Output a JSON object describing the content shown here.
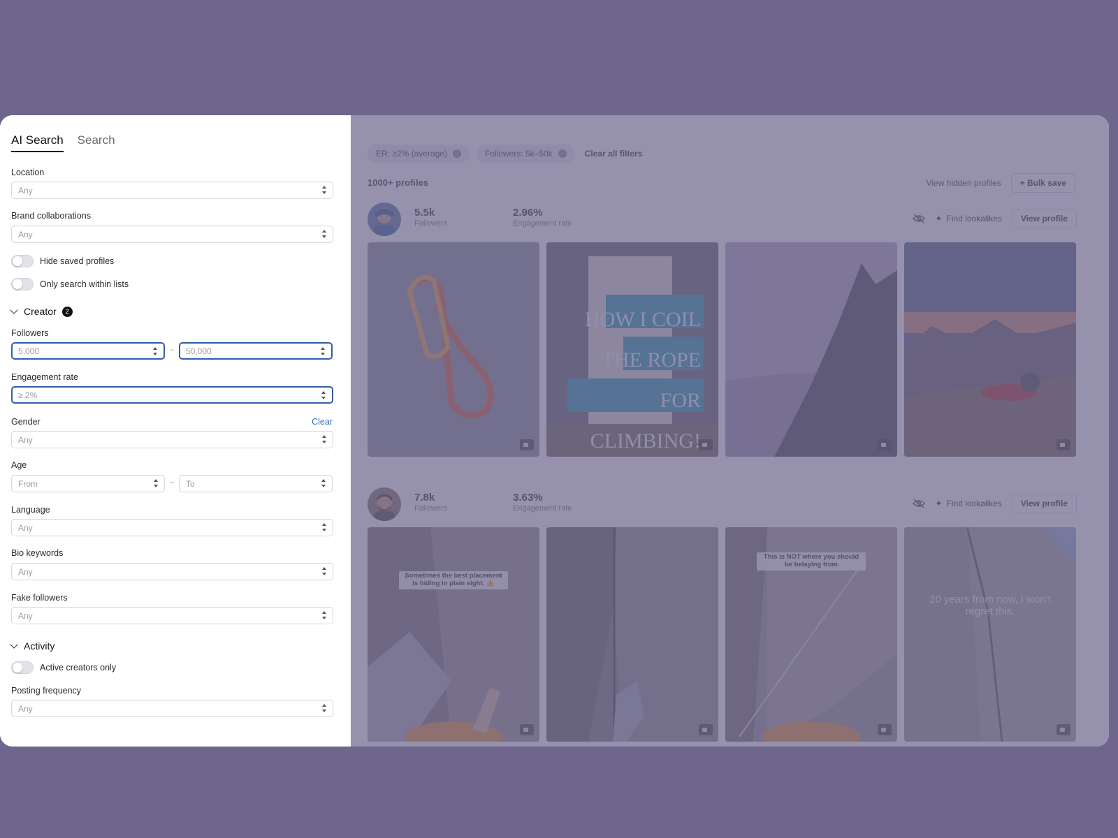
{
  "tabs": {
    "ai_search": "AI Search",
    "search": "Search"
  },
  "filters": {
    "location": {
      "label": "Location",
      "value": "Any"
    },
    "brand": {
      "label": "Brand collaborations",
      "value": "Any"
    },
    "hide_saved": "Hide saved profiles",
    "only_lists": "Only search within lists",
    "creator_section": "Creator",
    "creator_badge": "2",
    "followers": {
      "label": "Followers",
      "min": "5,000",
      "max": "50,000",
      "sep": "–"
    },
    "engagement": {
      "label": "Engagement rate",
      "value": "≥ 2%"
    },
    "gender": {
      "label": "Gender",
      "clear": "Clear",
      "value": "Any"
    },
    "age": {
      "label": "Age",
      "from": "From",
      "to": "To",
      "sep": "–"
    },
    "language": {
      "label": "Language",
      "value": "Any"
    },
    "bio": {
      "label": "Bio keywords",
      "value": "Any"
    },
    "fake": {
      "label": "Fake followers",
      "value": "Any"
    },
    "activity_section": "Activity",
    "active_only": "Active creators only",
    "posting": {
      "label": "Posting frequency",
      "value": "Any"
    }
  },
  "chips": [
    {
      "label": "ER: ≥2% (average)"
    },
    {
      "label": "Followers: 5k–50k"
    }
  ],
  "clear_all": "Clear all filters",
  "results_count": "1000+ profiles",
  "view_hidden": "View hidden profiles",
  "bulk_save": "+ Bulk save",
  "creators": [
    {
      "followers_value": "5.5k",
      "followers_label": "Followers",
      "er_value": "2.96%",
      "er_label": "Engagement rate",
      "find_label": "Find lookalikes",
      "view_label": "View profile",
      "thumb_captions": [
        "",
        "HOW I COIL THE ROPE FOR CLIMBING!",
        "",
        ""
      ]
    },
    {
      "followers_value": "7.8k",
      "followers_label": "Followers",
      "er_value": "3.63%",
      "er_label": "Engagement rate",
      "find_label": "Find lookalikes",
      "view_label": "View profile",
      "thumb_captions": [
        "Sometimes the best placement is hiding in plain sight. 👍",
        "",
        "This is NOT where you should be belaying from",
        "20 years from now, I won't regret this."
      ]
    }
  ],
  "colors": {
    "backdrop": "#6e668c",
    "focus": "#2f5fa8",
    "link": "#2f6bb3"
  }
}
